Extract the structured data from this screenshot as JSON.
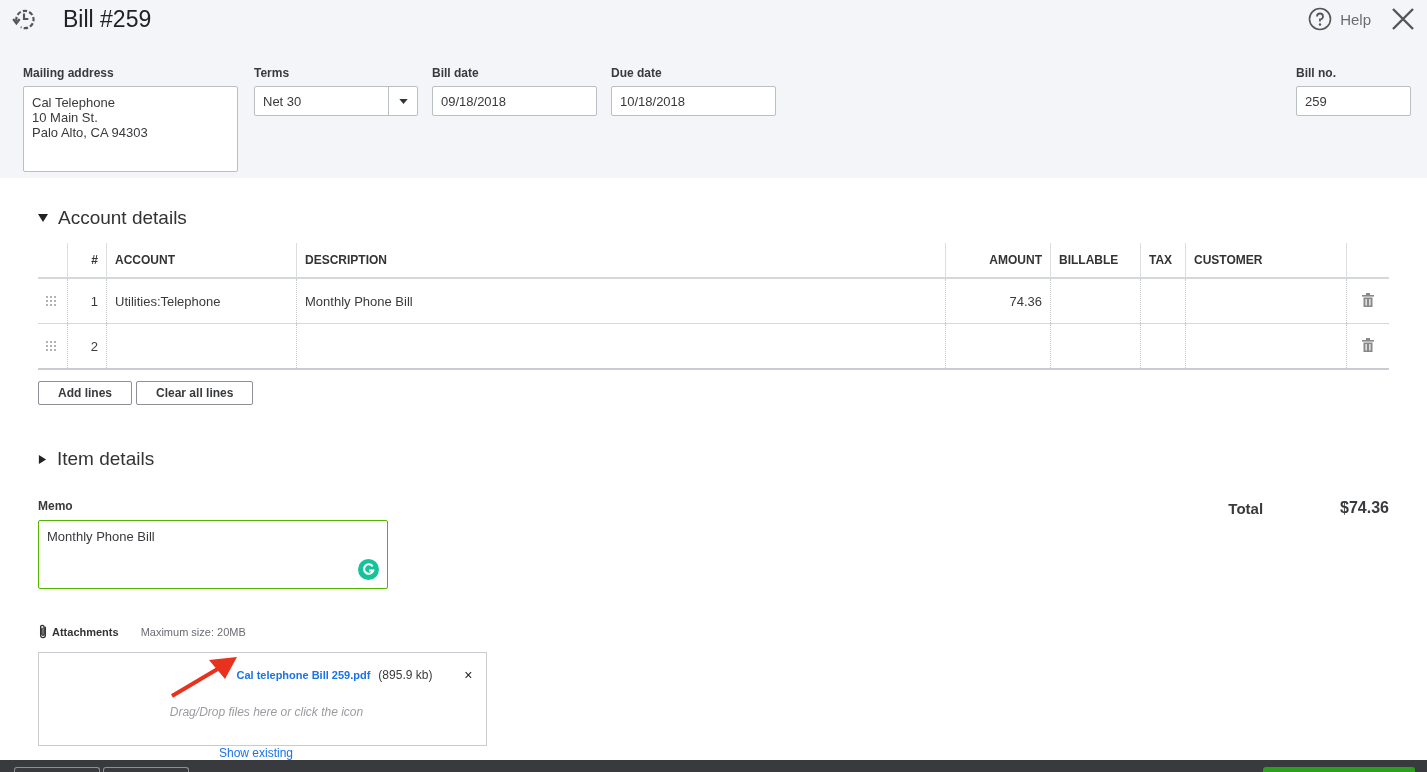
{
  "header": {
    "title": "Bill #259",
    "help": "Help"
  },
  "fields": [
    {
      "kind": "textarea",
      "label": "Mailing address",
      "value": "Cal Telephone\n10 Main St.\nPalo Alto, CA  94303"
    },
    {
      "kind": "select",
      "label": "Terms",
      "value": "Net 30"
    },
    {
      "kind": "text",
      "label": "Bill date",
      "value": "09/18/2018"
    },
    {
      "kind": "text",
      "label": "Due date",
      "value": "10/18/2018"
    }
  ],
  "bill_no": {
    "label": "Bill no.",
    "value": "259"
  },
  "account_details": {
    "title": "Account details",
    "expanded": true,
    "columns": [
      "#",
      "ACCOUNT",
      "DESCRIPTION",
      "AMOUNT",
      "BILLABLE",
      "TAX",
      "CUSTOMER"
    ],
    "rows": [
      {
        "number": "1",
        "account": "Utilities:Telephone",
        "description": "Monthly Phone Bill",
        "amount": "74.36"
      },
      {
        "number": "2"
      }
    ],
    "buttons": [
      "Add lines",
      "Clear all lines"
    ]
  },
  "item_details": {
    "title": "Item details",
    "expanded": false
  },
  "memo": {
    "label": "Memo",
    "value": "Monthly Phone Bill"
  },
  "total": {
    "label": "Total",
    "value": "$74.36"
  },
  "attachments": {
    "label": "Attachments",
    "max_size": "Maximum size: 20MB",
    "file": "Cal telephone Bill 259.pdf",
    "file_size": "(895.9 kb)",
    "remove": "×",
    "drop_hint": "Drag/Drop files here or click the icon",
    "show_existing": "Show existing"
  }
}
